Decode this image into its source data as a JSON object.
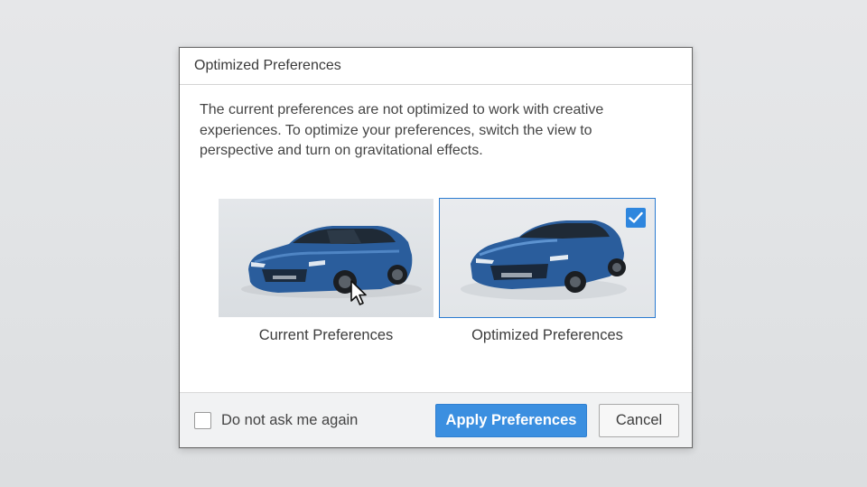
{
  "dialog": {
    "title": "Optimized Preferences",
    "message": "The current preferences are not optimized to work with creative experiences. To optimize your preferences, switch the view to perspective and turn on gravitational effects.",
    "options": [
      {
        "label": "Current Preferences",
        "selected": false
      },
      {
        "label": "Optimized Preferences",
        "selected": true
      }
    ],
    "footer": {
      "dont_ask_label": "Do not ask me again",
      "dont_ask_checked": false,
      "apply_label": "Apply Preferences",
      "cancel_label": "Cancel"
    }
  },
  "colors": {
    "accent": "#3b8fe0",
    "car_body": "#2a5d9c"
  },
  "icons": {
    "selected_indicator": "checkmark-icon",
    "pointer": "mouse-cursor-icon"
  }
}
